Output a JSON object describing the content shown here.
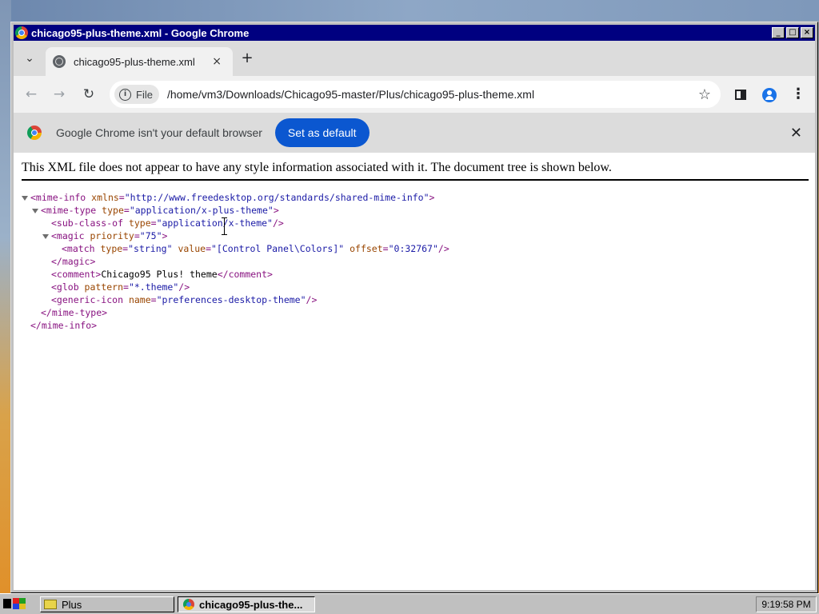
{
  "window": {
    "title": "chicago95-plus-theme.xml - Google Chrome",
    "controls": [
      "_",
      "□",
      "×"
    ]
  },
  "tabstrip": {
    "dropdown_icon": "chevron-down-icon",
    "tab_title": "chicago95-plus-theme.xml",
    "tab_close": "×",
    "new_tab": "+"
  },
  "toolbar": {
    "back": "←",
    "forward": "→",
    "reload": "↻",
    "chip_label": "File",
    "url": "/home/vm3/Downloads/Chicago95-master/Plus/chicago95-plus-theme.xml",
    "star": "☆",
    "menu": "⋮"
  },
  "infobar": {
    "message": "Google Chrome isn't your default browser",
    "button": "Set as default",
    "close": "✕"
  },
  "content": {
    "notice": "This XML file does not appear to have any style information associated with it. The document tree is shown below.",
    "xml_lines": [
      {
        "indent": 0,
        "toggle": true,
        "parts": [
          [
            "tag",
            "<mime-info "
          ],
          [
            "an",
            "xmlns"
          ],
          [
            "tag",
            "="
          ],
          [
            "av",
            "\"http://www.freedesktop.org/standards/shared-mime-info\""
          ],
          [
            "tag",
            ">"
          ]
        ]
      },
      {
        "indent": 1,
        "toggle": true,
        "parts": [
          [
            "tag",
            "<mime-type "
          ],
          [
            "an",
            "type"
          ],
          [
            "tag",
            "="
          ],
          [
            "av",
            "\"application/x-plus-theme\""
          ],
          [
            "tag",
            ">"
          ]
        ]
      },
      {
        "indent": 2,
        "toggle": false,
        "parts": [
          [
            "tag",
            "<sub-class-of "
          ],
          [
            "an",
            "type"
          ],
          [
            "tag",
            "="
          ],
          [
            "av",
            "\"application/x-theme\""
          ],
          [
            "tag",
            "/>"
          ]
        ]
      },
      {
        "indent": 2,
        "toggle": true,
        "parts": [
          [
            "tag",
            "<magic "
          ],
          [
            "an",
            "priority"
          ],
          [
            "tag",
            "="
          ],
          [
            "av",
            "\"75\""
          ],
          [
            "tag",
            ">"
          ]
        ]
      },
      {
        "indent": 3,
        "toggle": false,
        "parts": [
          [
            "tag",
            "<match "
          ],
          [
            "an",
            "type"
          ],
          [
            "tag",
            "="
          ],
          [
            "av",
            "\"string\""
          ],
          [
            "tag",
            " "
          ],
          [
            "an",
            "value"
          ],
          [
            "tag",
            "="
          ],
          [
            "av",
            "\"[Control Panel\\Colors]\""
          ],
          [
            "tag",
            " "
          ],
          [
            "an",
            "offset"
          ],
          [
            "tag",
            "="
          ],
          [
            "av",
            "\"0:32767\""
          ],
          [
            "tag",
            "/>"
          ]
        ]
      },
      {
        "indent": 2,
        "toggle": false,
        "parts": [
          [
            "tag",
            "</magic>"
          ]
        ]
      },
      {
        "indent": 2,
        "toggle": false,
        "parts": [
          [
            "tag",
            "<comment>"
          ],
          [
            "tx",
            "Chicago95 Plus! theme"
          ],
          [
            "tag",
            "</comment>"
          ]
        ]
      },
      {
        "indent": 2,
        "toggle": false,
        "parts": [
          [
            "tag",
            "<glob "
          ],
          [
            "an",
            "pattern"
          ],
          [
            "tag",
            "="
          ],
          [
            "av",
            "\"*.theme\""
          ],
          [
            "tag",
            "/>"
          ]
        ]
      },
      {
        "indent": 2,
        "toggle": false,
        "parts": [
          [
            "tag",
            "<generic-icon "
          ],
          [
            "an",
            "name"
          ],
          [
            "tag",
            "="
          ],
          [
            "av",
            "\"preferences-desktop-theme\""
          ],
          [
            "tag",
            "/>"
          ]
        ]
      },
      {
        "indent": 1,
        "toggle": false,
        "parts": [
          [
            "tag",
            "</mime-type>"
          ]
        ]
      },
      {
        "indent": 0,
        "toggle": false,
        "parts": [
          [
            "tag",
            "</mime-info>"
          ]
        ]
      }
    ]
  },
  "taskbar": {
    "items": [
      {
        "label": "Plus",
        "icon": "folder-icon"
      },
      {
        "label": "chicago95-plus-the...",
        "icon": "chrome-icon"
      }
    ],
    "clock": "9:19:58 PM"
  },
  "colors": {
    "titlebar": "#000080",
    "accent_button": "#0b57d0",
    "xml_tag": "#881280",
    "xml_attr_name": "#994500",
    "xml_attr_value": "#1a1aa6"
  }
}
